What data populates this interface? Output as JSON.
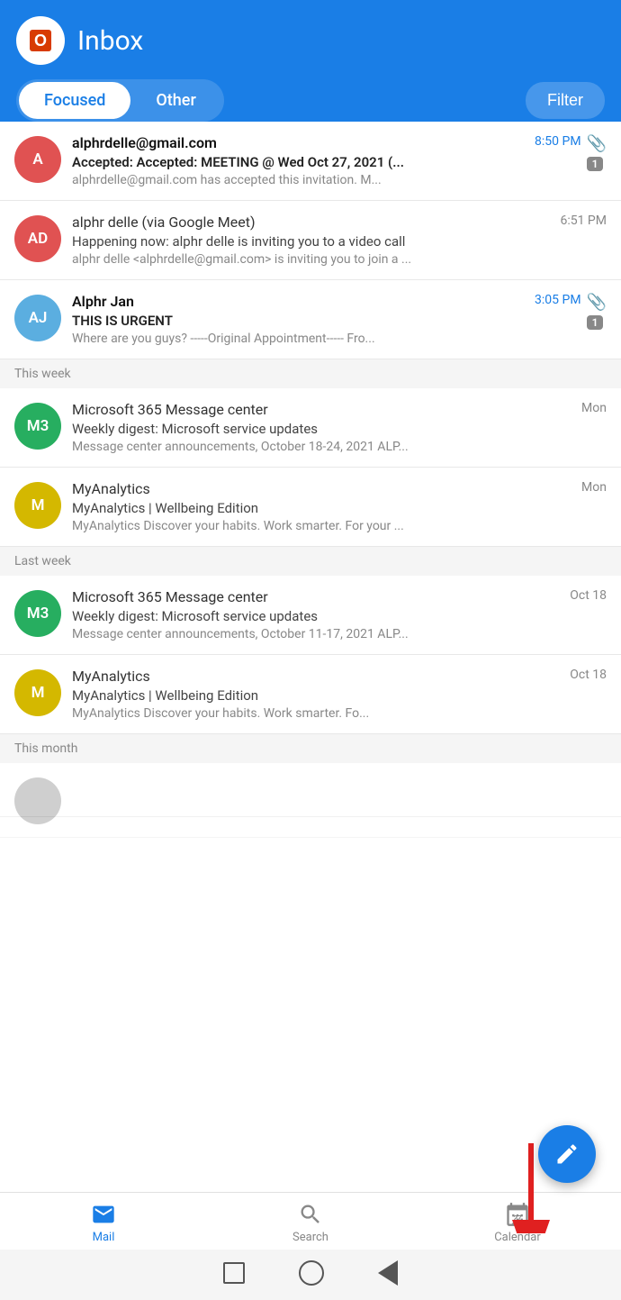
{
  "header": {
    "title": "Inbox",
    "tab_focused": "Focused",
    "tab_other": "Other",
    "filter_label": "Filter"
  },
  "emails": {
    "today": [
      {
        "id": "email-1",
        "avatar_text": "A",
        "avatar_color": "#e05252",
        "sender": "alphrdelle@gmail.com",
        "sender_bold": true,
        "time": "8:50 PM",
        "time_blue": true,
        "subject": "Accepted: Accepted: MEETING @ Wed Oct 27, 2021 (...",
        "subject_bold": true,
        "preview": "alphrdelle@gmail.com has accepted this invitation. M...",
        "has_attachment": true,
        "badge": "1"
      },
      {
        "id": "email-2",
        "avatar_text": "AD",
        "avatar_color": "#e05252",
        "sender": "alphr delle (via Google Meet)",
        "sender_bold": false,
        "time": "6:51 PM",
        "time_blue": false,
        "subject": "Happening now: alphr delle is inviting you to a video call",
        "subject_bold": false,
        "preview": "alphr delle <alphrdelle@gmail.com> is inviting you to join a ...",
        "has_attachment": false,
        "badge": ""
      },
      {
        "id": "email-3",
        "avatar_text": "AJ",
        "avatar_color": "#5baee0",
        "sender": "Alphr Jan",
        "sender_bold": true,
        "time": "3:05 PM",
        "time_blue": true,
        "subject": "THIS IS URGENT",
        "subject_bold": true,
        "preview": "Where are you guys? -----Original Appointment----- Fro...",
        "has_attachment": true,
        "badge": "1"
      }
    ],
    "this_week_label": "This week",
    "this_week": [
      {
        "id": "email-4",
        "avatar_text": "M3",
        "avatar_color": "#27ae60",
        "sender": "Microsoft 365 Message center",
        "sender_bold": false,
        "time": "Mon",
        "time_blue": false,
        "subject": "Weekly digest: Microsoft service updates",
        "subject_bold": false,
        "preview": "Message center announcements, October 18-24, 2021 ALP...",
        "has_attachment": false,
        "badge": ""
      },
      {
        "id": "email-5",
        "avatar_text": "M",
        "avatar_color": "#d4b800",
        "sender": "MyAnalytics",
        "sender_bold": false,
        "time": "Mon",
        "time_blue": false,
        "subject": "MyAnalytics | Wellbeing Edition",
        "subject_bold": false,
        "preview": "MyAnalytics Discover your habits. Work smarter. For your ...",
        "has_attachment": false,
        "badge": ""
      }
    ],
    "last_week_label": "Last week",
    "last_week": [
      {
        "id": "email-6",
        "avatar_text": "M3",
        "avatar_color": "#27ae60",
        "sender": "Microsoft 365 Message center",
        "sender_bold": false,
        "time": "Oct 18",
        "time_blue": false,
        "subject": "Weekly digest: Microsoft service updates",
        "subject_bold": false,
        "preview": "Message center announcements, October 11-17, 2021 ALP...",
        "has_attachment": false,
        "badge": ""
      },
      {
        "id": "email-7",
        "avatar_text": "M",
        "avatar_color": "#d4b800",
        "sender": "MyAnalytics",
        "sender_bold": false,
        "time": "Oct 18",
        "time_blue": false,
        "subject": "MyAnalytics | Wellbeing Edition",
        "subject_bold": false,
        "preview": "MyAnalytics Discover your habits. Work smarter. Fo...",
        "has_attachment": false,
        "badge": ""
      }
    ],
    "this_month_label": "This month"
  },
  "bottom_nav": {
    "mail_label": "Mail",
    "search_label": "Search",
    "calendar_label": "Calendar"
  },
  "fab": {
    "label": "compose"
  },
  "colors": {
    "brand_blue": "#1a7ee6"
  }
}
